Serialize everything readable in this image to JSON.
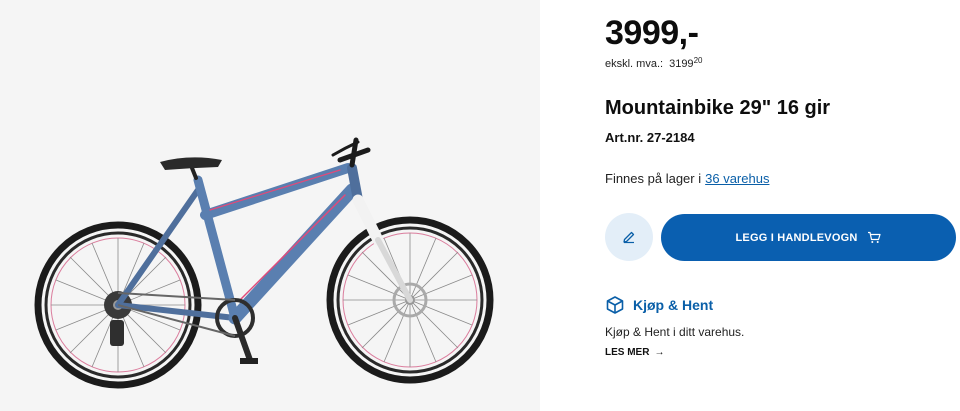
{
  "product": {
    "price": "3999,-",
    "price_excl_label": "ekskl. mva.:",
    "price_excl_main": "3199",
    "price_excl_cents": "20",
    "title": "Mountainbike 29\" 16 gir",
    "article_number": "Art.nr. 27-2184",
    "image_alt": "Blue Yosemite mountain bike"
  },
  "stock": {
    "text": "Finnes på lager i",
    "link_text": "36 varehus"
  },
  "actions": {
    "edit_icon": "pencil-icon",
    "add_to_cart_label": "LEGG I HANDLEVOGN",
    "cart_icon": "cart-icon"
  },
  "click_collect": {
    "icon": "box-icon",
    "title": "Kjøp & Hent",
    "description": "Kjøp & Hent i ditt varehus.",
    "read_more": "LES MER",
    "arrow": "→"
  },
  "colors": {
    "brand_blue": "#0a5fb0",
    "link_blue": "#0a5fa8",
    "edit_bg": "#e3eef8",
    "frame_blue": "#5a7fb0",
    "accent_pink": "#e04a7a"
  }
}
